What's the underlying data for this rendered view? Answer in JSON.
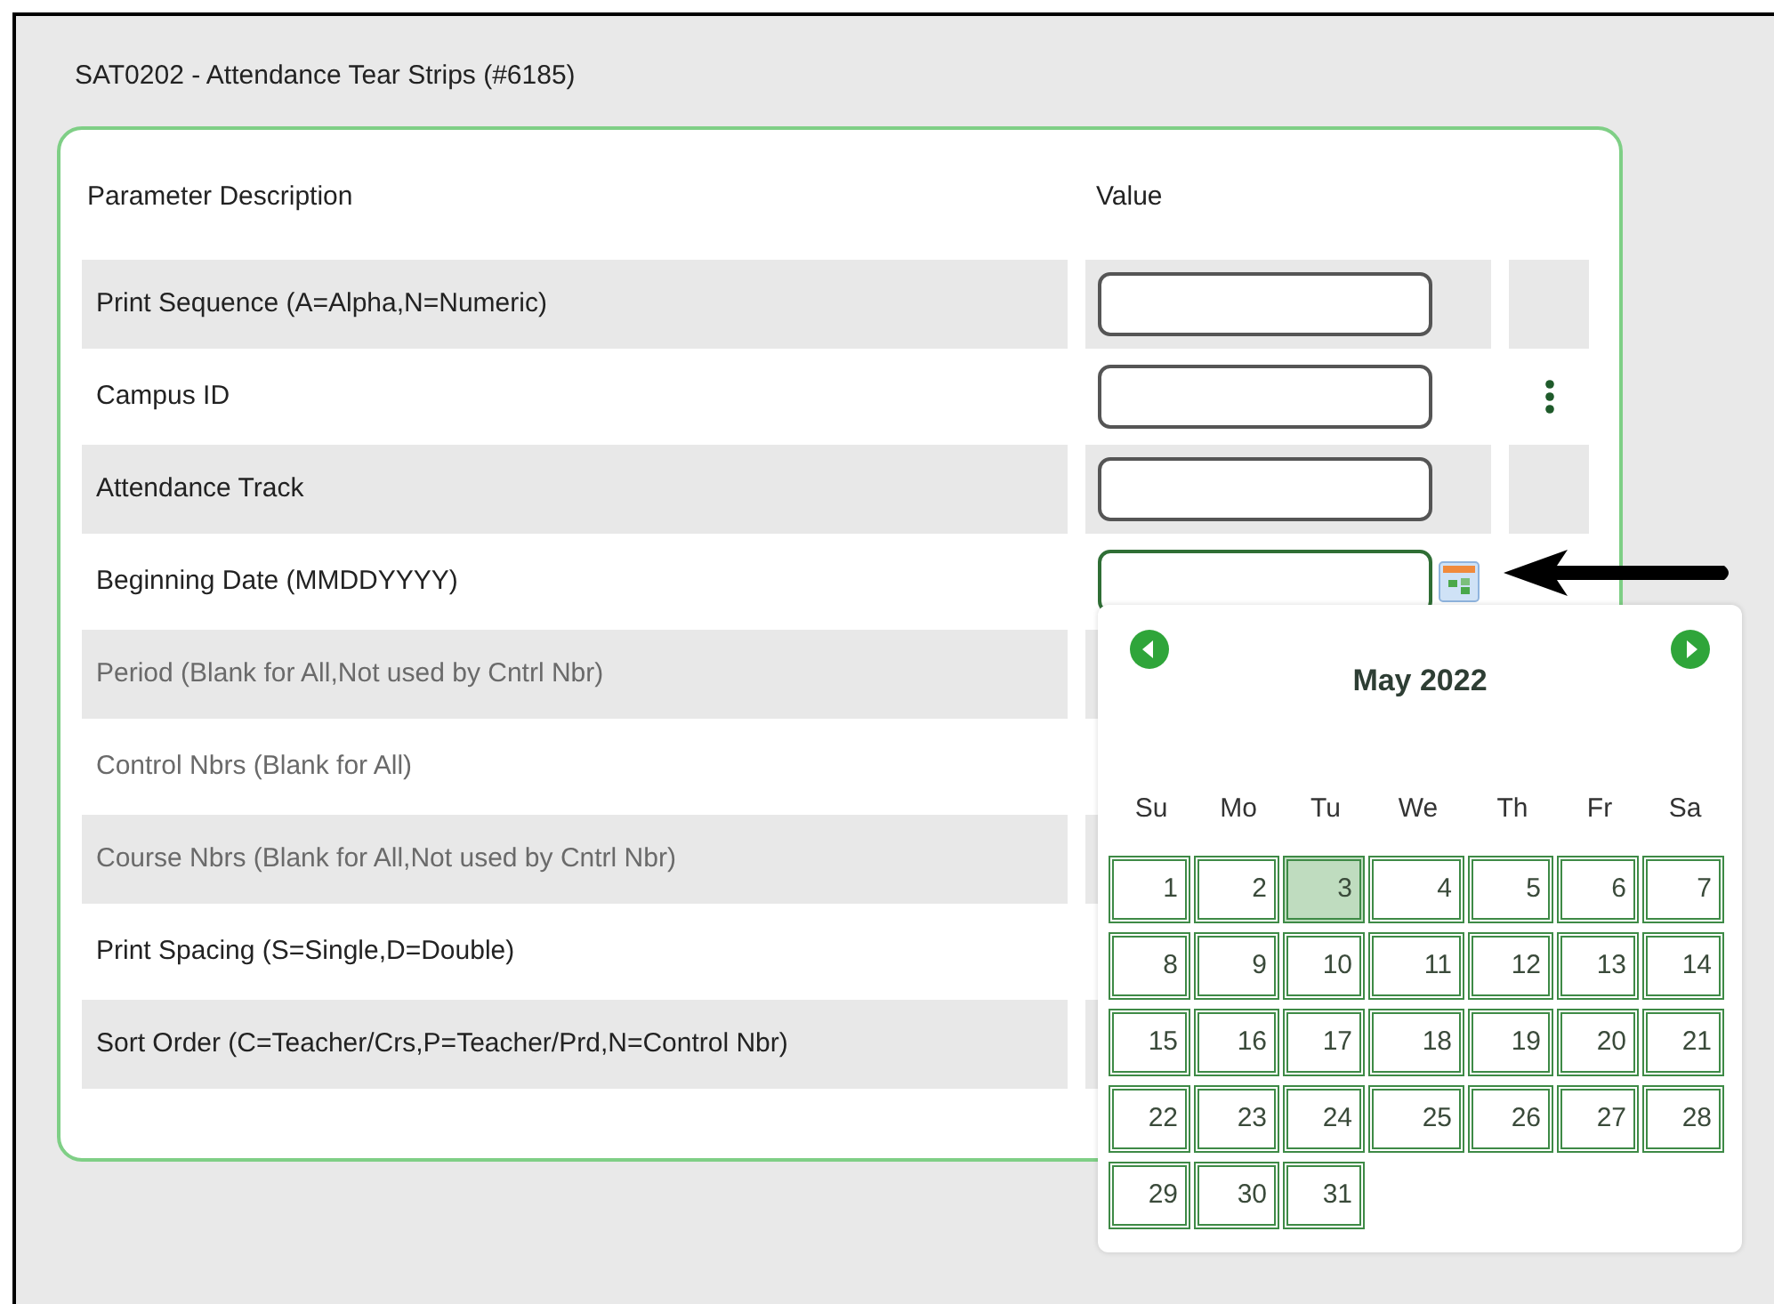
{
  "window": {
    "title": "SAT0202 - Attendance Tear Strips (#6185)"
  },
  "table": {
    "columns": [
      "Parameter Description",
      "Value"
    ],
    "rows": [
      {
        "description": "Print Sequence (A=Alpha,N=Numeric)",
        "disabled": false,
        "kind": "text"
      },
      {
        "description": "Campus ID",
        "disabled": false,
        "kind": "lookup"
      },
      {
        "description": "Attendance Track",
        "disabled": false,
        "kind": "text"
      },
      {
        "description": "Beginning Date (MMDDYYYY)",
        "disabled": false,
        "kind": "date"
      },
      {
        "description": "Period (Blank for All,Not used by Cntrl Nbr)",
        "disabled": true
      },
      {
        "description": "Control Nbrs (Blank for All)",
        "disabled": true
      },
      {
        "description": "Course Nbrs (Blank for All,Not used by Cntrl Nbr)",
        "disabled": true
      },
      {
        "description": "Print Spacing (S=Single,D=Double)",
        "disabled": false
      },
      {
        "description": "Sort Order (C=Teacher/Crs,P=Teacher/Prd,N=Control Nbr)",
        "disabled": false
      }
    ]
  },
  "calendar": {
    "month": "May 2022",
    "weekdays": [
      "Su",
      "Mo",
      "Tu",
      "We",
      "Th",
      "Fr",
      "Sa"
    ],
    "days": [
      {
        "label": "1",
        "selected": false
      },
      {
        "label": "2",
        "selected": false
      },
      {
        "label": "3",
        "selected": true
      },
      {
        "label": "4",
        "selected": false
      },
      {
        "label": "5",
        "selected": false
      },
      {
        "label": "6",
        "selected": false
      },
      {
        "label": "7",
        "selected": false
      },
      {
        "label": "8",
        "selected": false
      },
      {
        "label": "9",
        "selected": false
      },
      {
        "label": "10",
        "selected": false
      },
      {
        "label": "11",
        "selected": false
      },
      {
        "label": "12",
        "selected": false
      },
      {
        "label": "13",
        "selected": false
      },
      {
        "label": "14",
        "selected": false
      },
      {
        "label": "15",
        "selected": false
      },
      {
        "label": "16",
        "selected": false
      },
      {
        "label": "17",
        "selected": false
      },
      {
        "label": "18",
        "selected": false
      },
      {
        "label": "19",
        "selected": false
      },
      {
        "label": "20",
        "selected": false
      },
      {
        "label": "21",
        "selected": false
      },
      {
        "label": "22",
        "selected": false
      },
      {
        "label": "23",
        "selected": false
      },
      {
        "label": "24",
        "selected": false
      },
      {
        "label": "25",
        "selected": false
      },
      {
        "label": "26",
        "selected": false
      },
      {
        "label": "27",
        "selected": false
      },
      {
        "label": "28",
        "selected": false
      },
      {
        "label": "29",
        "selected": false
      },
      {
        "label": "30",
        "selected": false
      },
      {
        "label": "31",
        "selected": false
      }
    ]
  }
}
